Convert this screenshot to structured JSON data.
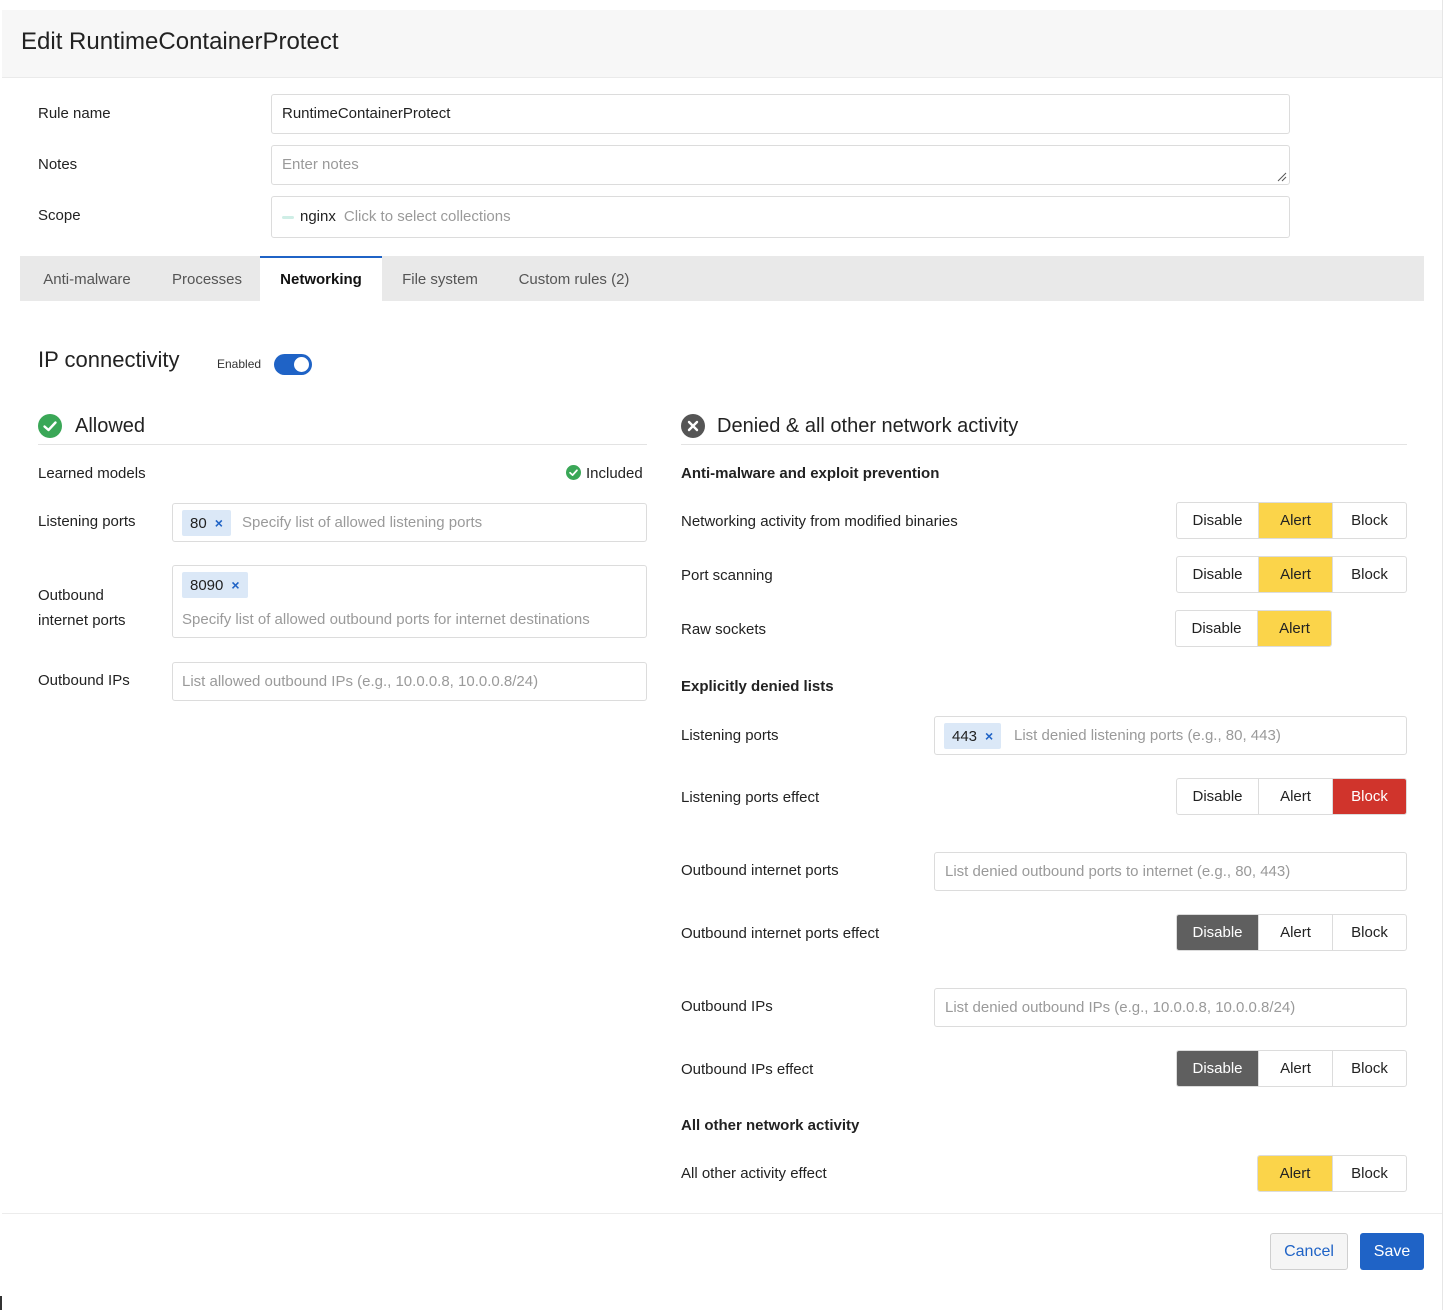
{
  "header": {
    "title": "Edit RuntimeContainerProtect"
  },
  "form": {
    "rule_name_label": "Rule name",
    "rule_name_value": "RuntimeContainerProtect",
    "notes_label": "Notes",
    "notes_placeholder": "Enter notes",
    "scope_label": "Scope",
    "scope_chip": "nginx",
    "scope_placeholder": "Click to select collections"
  },
  "tabs": [
    {
      "label": "Anti-malware"
    },
    {
      "label": "Processes"
    },
    {
      "label": "Networking"
    },
    {
      "label": "File system"
    },
    {
      "label": "Custom rules (2)"
    }
  ],
  "ip_connectivity": {
    "title": "IP connectivity",
    "toggle_label": "Enabled"
  },
  "allowed": {
    "title": "Allowed",
    "learned_models_label": "Learned models",
    "learned_models_status": "Included",
    "listening_ports_label": "Listening ports",
    "listening_ports_chip": "80",
    "listening_ports_placeholder": "Specify list of allowed listening ports",
    "outbound_ports_label_1": "Outbound",
    "outbound_ports_label_2": "internet ports",
    "outbound_ports_chip": "8090",
    "outbound_ports_placeholder": "Specify list of allowed outbound ports for internet destinations",
    "outbound_ips_label": "Outbound IPs",
    "outbound_ips_placeholder": "List allowed outbound IPs (e.g., 10.0.0.8, 10.0.0.8/24)"
  },
  "denied": {
    "title": "Denied & all other network activity",
    "anti_malware_heading": "Anti-malware and exploit prevention",
    "modified_binaries_label": "Networking activity from modified binaries",
    "port_scanning_label": "Port scanning",
    "raw_sockets_label": "Raw sockets",
    "explicit_heading": "Explicitly denied lists",
    "listening_ports_label": "Listening ports",
    "listening_ports_chip": "443",
    "listening_ports_placeholder": "List denied listening ports (e.g., 80, 443)",
    "listening_effect_label": "Listening ports effect",
    "outbound_ports_label": "Outbound internet ports",
    "outbound_ports_placeholder": "List denied outbound ports to internet (e.g., 80, 443)",
    "outbound_ports_effect_label": "Outbound internet ports effect",
    "outbound_ips_label": "Outbound IPs",
    "outbound_ips_placeholder": "List denied outbound IPs (e.g., 10.0.0.8, 10.0.0.8/24)",
    "outbound_ips_effect_label": "Outbound IPs effect",
    "all_other_heading": "All other network activity",
    "all_other_effect_label": "All other activity effect"
  },
  "effect": {
    "disable": "Disable",
    "alert": "Alert",
    "block": "Block"
  },
  "footer": {
    "cancel": "Cancel",
    "save": "Save"
  },
  "colors": {
    "accent": "#1f63c6",
    "alert": "#fbd44a",
    "block": "#d0342c",
    "disable_active": "#5f5f5f",
    "success": "#3aa757"
  }
}
